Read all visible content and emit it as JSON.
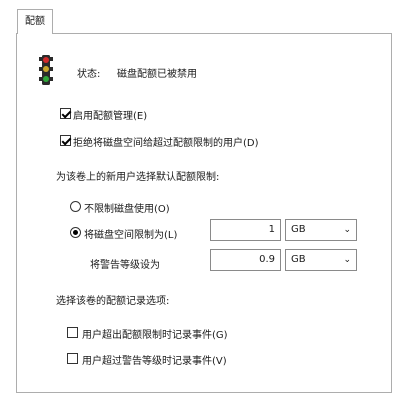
{
  "tab": {
    "label": "配额"
  },
  "status": {
    "label": "状态:",
    "value": "磁盘配额已被禁用"
  },
  "options": {
    "enable_quota": {
      "label": "启用配额管理(E)",
      "checked": true
    },
    "deny_space": {
      "label": "拒绝将磁盘空间给超过配额限制的用户(D)",
      "checked": true
    }
  },
  "default_limit": {
    "heading": "为该卷上的新用户选择默认配额限制:",
    "no_limit": {
      "label": "不限制磁盘使用(O)",
      "selected": false
    },
    "limit_to": {
      "label": "将磁盘空间限制为(L)",
      "selected": true
    },
    "limit_value": "1",
    "limit_unit": "GB",
    "warning_label": "将警告等级设为",
    "warning_value": "0.9",
    "warning_unit": "GB"
  },
  "logging": {
    "heading": "选择该卷的配额记录选项:",
    "log_limit": {
      "label": "用户超出配额限制时记录事件(G)",
      "checked": false
    },
    "log_warning": {
      "label": "用户超过警告等级时记录事件(V)",
      "checked": false
    }
  },
  "icons": {
    "traffic_light": "traffic-light-icon",
    "dropdown": "chevron-down-icon"
  },
  "colors": {
    "border": "#adadad",
    "light_red": "#d12a2a",
    "light_yellow": "#c7a62a",
    "light_green": "#2fa83a"
  }
}
